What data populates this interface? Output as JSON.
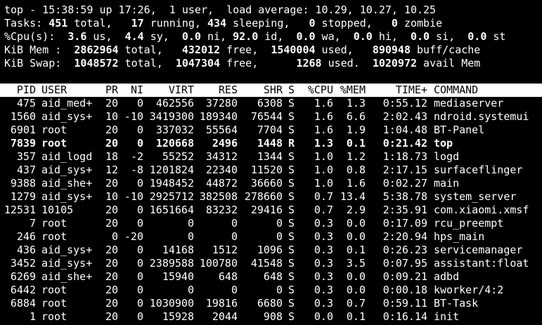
{
  "summary": {
    "top_line": "top - 15:38:59 up 17:26,  1 user,  load average: 10.29, 10.27, 10.25",
    "tasks": {
      "label": "Tasks:",
      "total": "451",
      "total_l": " total,",
      "running": "17",
      "running_l": " running,",
      "sleeping": "434",
      "sleeping_l": " sleeping,",
      "stopped": "0",
      "stopped_l": " stopped,",
      "zombie": "0",
      "zombie_l": " zombie"
    },
    "cpu": {
      "label": "%Cpu(s):",
      "us": "3.6",
      "us_l": " us,",
      "sy": "4.4",
      "sy_l": " sy,",
      "ni": "0.0",
      "ni_l": " ni,",
      "id": "92.0",
      "id_l": " id,",
      "wa": "0.0",
      "wa_l": " wa,",
      "hi": "0.0",
      "hi_l": " hi,",
      "si": "0.0",
      "si_l": " si,",
      "st": "0.0",
      "st_l": " st"
    },
    "mem": {
      "label": "KiB Mem :",
      "total": "2862964",
      "total_l": " total,",
      "free": "432012",
      "free_l": " free,",
      "used": "1540004",
      "used_l": " used,",
      "buff": "890948",
      "buff_l": " buff/cache"
    },
    "swap": {
      "label": "KiB Swap:",
      "total": "1048572",
      "total_l": " total,",
      "free": "1047304",
      "free_l": " free,",
      "used": "1268",
      "used_l": " used.",
      "avail": "1020972",
      "avail_l": " avail Mem"
    }
  },
  "columns": {
    "pid": "PID",
    "user": "USER",
    "pr": "PR",
    "ni": "NI",
    "virt": "VIRT",
    "res": "RES",
    "shr": "SHR",
    "s": "S",
    "cpu": "%CPU",
    "mem": "%MEM",
    "time": "TIME+",
    "cmd": "COMMAND"
  },
  "processes": [
    {
      "pid": "475",
      "user": "aid_med+",
      "pr": "20",
      "ni": "0",
      "virt": "462556",
      "res": "37280",
      "shr": "6308",
      "s": "S",
      "cpu": "1.6",
      "mem": "1.3",
      "time": "0:55.12",
      "cmd": "mediaserver",
      "bold": false
    },
    {
      "pid": "1560",
      "user": "aid_sys+",
      "pr": "10",
      "ni": "-10",
      "virt": "3419300",
      "res": "189340",
      "shr": "76544",
      "s": "S",
      "cpu": "1.6",
      "mem": "6.6",
      "time": "2:02.43",
      "cmd": "ndroid.systemui",
      "bold": false
    },
    {
      "pid": "6901",
      "user": "root",
      "pr": "20",
      "ni": "0",
      "virt": "337032",
      "res": "55564",
      "shr": "7704",
      "s": "S",
      "cpu": "1.6",
      "mem": "1.9",
      "time": "1:04.48",
      "cmd": "BT-Panel",
      "bold": false
    },
    {
      "pid": "7839",
      "user": "root",
      "pr": "20",
      "ni": "0",
      "virt": "120668",
      "res": "2496",
      "shr": "1448",
      "s": "R",
      "cpu": "1.3",
      "mem": "0.1",
      "time": "0:21.42",
      "cmd": "top",
      "bold": true
    },
    {
      "pid": "357",
      "user": "aid_logd",
      "pr": "18",
      "ni": "-2",
      "virt": "55252",
      "res": "34312",
      "shr": "1344",
      "s": "S",
      "cpu": "1.0",
      "mem": "1.2",
      "time": "1:18.73",
      "cmd": "logd",
      "bold": false
    },
    {
      "pid": "437",
      "user": "aid_sys+",
      "pr": "12",
      "ni": "-8",
      "virt": "1201824",
      "res": "22340",
      "shr": "11520",
      "s": "S",
      "cpu": "1.0",
      "mem": "0.8",
      "time": "2:17.15",
      "cmd": "surfaceflinger",
      "bold": false
    },
    {
      "pid": "9388",
      "user": "aid_she+",
      "pr": "20",
      "ni": "0",
      "virt": "1948452",
      "res": "44872",
      "shr": "36660",
      "s": "S",
      "cpu": "1.0",
      "mem": "1.6",
      "time": "0:02.27",
      "cmd": "main",
      "bold": false
    },
    {
      "pid": "1279",
      "user": "aid_sys+",
      "pr": "10",
      "ni": "-10",
      "virt": "2925712",
      "res": "382508",
      "shr": "278660",
      "s": "S",
      "cpu": "0.7",
      "mem": "13.4",
      "time": "5:38.78",
      "cmd": "system_server",
      "bold": false
    },
    {
      "pid": "12531",
      "user": "10105",
      "pr": "20",
      "ni": "0",
      "virt": "1651664",
      "res": "83232",
      "shr": "29416",
      "s": "S",
      "cpu": "0.7",
      "mem": "2.9",
      "time": "2:35.91",
      "cmd": "com.xiaomi.xmsf",
      "bold": false
    },
    {
      "pid": "7",
      "user": "root",
      "pr": "20",
      "ni": "0",
      "virt": "0",
      "res": "0",
      "shr": "0",
      "s": "S",
      "cpu": "0.3",
      "mem": "0.0",
      "time": "0:17.09",
      "cmd": "rcu_preempt",
      "bold": false
    },
    {
      "pid": "246",
      "user": "root",
      "pr": "0",
      "ni": "-20",
      "virt": "0",
      "res": "0",
      "shr": "0",
      "s": "S",
      "cpu": "0.3",
      "mem": "0.0",
      "time": "2:20.94",
      "cmd": "hps_main",
      "bold": false
    },
    {
      "pid": "436",
      "user": "aid_sys+",
      "pr": "20",
      "ni": "0",
      "virt": "14168",
      "res": "1512",
      "shr": "1096",
      "s": "S",
      "cpu": "0.3",
      "mem": "0.1",
      "time": "0:26.23",
      "cmd": "servicemanager",
      "bold": false
    },
    {
      "pid": "3452",
      "user": "aid_sys+",
      "pr": "20",
      "ni": "0",
      "virt": "2389588",
      "res": "100780",
      "shr": "41548",
      "s": "S",
      "cpu": "0.3",
      "mem": "3.5",
      "time": "0:07.95",
      "cmd": "assistant:float",
      "bold": false
    },
    {
      "pid": "6269",
      "user": "aid_she+",
      "pr": "20",
      "ni": "0",
      "virt": "15940",
      "res": "648",
      "shr": "648",
      "s": "S",
      "cpu": "0.3",
      "mem": "0.0",
      "time": "0:09.21",
      "cmd": "adbd",
      "bold": false
    },
    {
      "pid": "6442",
      "user": "root",
      "pr": "20",
      "ni": "0",
      "virt": "0",
      "res": "0",
      "shr": "0",
      "s": "S",
      "cpu": "0.3",
      "mem": "0.0",
      "time": "0:00.18",
      "cmd": "kworker/4:2",
      "bold": false
    },
    {
      "pid": "6884",
      "user": "root",
      "pr": "20",
      "ni": "0",
      "virt": "1030900",
      "res": "19816",
      "shr": "6680",
      "s": "S",
      "cpu": "0.3",
      "mem": "0.7",
      "time": "0:59.11",
      "cmd": "BT-Task",
      "bold": false
    },
    {
      "pid": "1",
      "user": "root",
      "pr": "20",
      "ni": "0",
      "virt": "15928",
      "res": "2044",
      "shr": "908",
      "s": "S",
      "cpu": "0.0",
      "mem": "0.1",
      "time": "0:16.14",
      "cmd": "init",
      "bold": false
    }
  ]
}
